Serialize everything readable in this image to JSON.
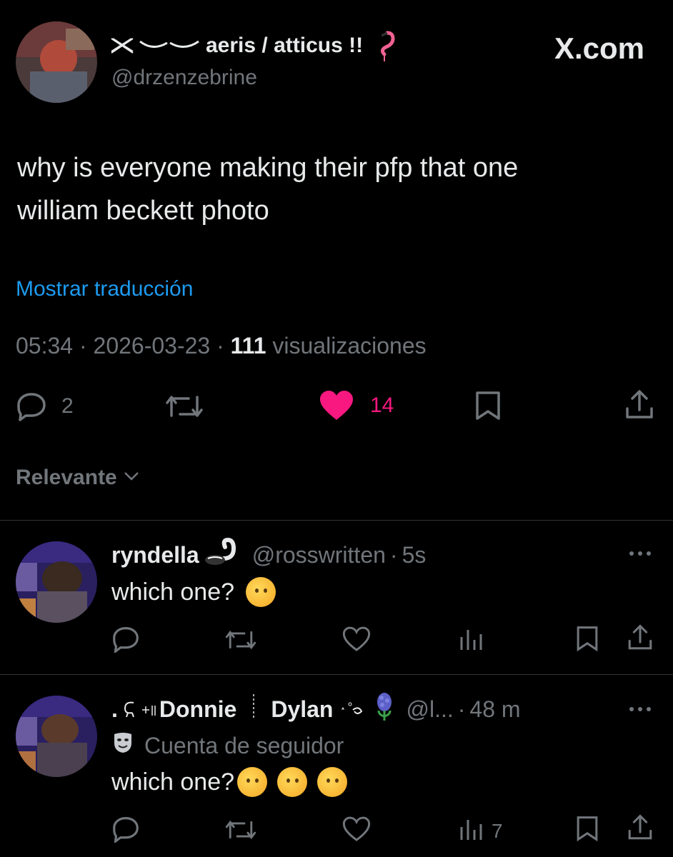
{
  "watermark": "X.com",
  "post": {
    "author_name": "aeris / atticus !!",
    "author_handle": "@drzenzebrine",
    "text_line1": "why is everyone making their pfp that one",
    "text_line2": "william beckett photo",
    "translate_link": "Mostrar traducción",
    "time": "05:34",
    "date": "2026-03-23",
    "views_count": "111",
    "views_label": "visualizaciones",
    "reply_count": "2",
    "like_count": "14",
    "colors": {
      "like": "#f91880",
      "link": "#1d9bf0",
      "muted": "#71767b"
    }
  },
  "sort": {
    "label": "Relevante"
  },
  "replies": [
    {
      "name": "ryndella",
      "handle": "@rosswritten",
      "time": "5s",
      "text": "which one?",
      "views": ""
    },
    {
      "name_part1": "Donnie",
      "name_part2": "Dylan",
      "handle": "@l...",
      "time": "48 m",
      "label": "Cuenta de seguidor",
      "text": "which one?",
      "views": "7"
    }
  ]
}
